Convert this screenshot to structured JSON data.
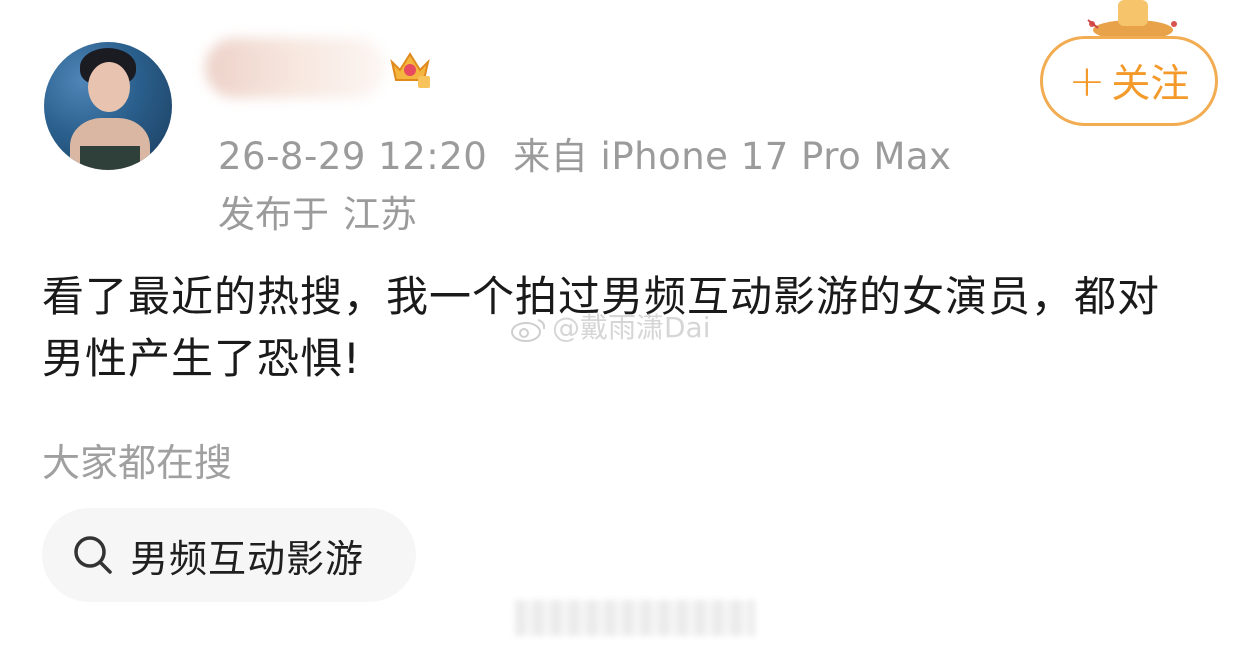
{
  "post": {
    "author": {
      "name_blurred": true,
      "avatar_alt": "avatar",
      "badge_icon": "crown-badge-icon"
    },
    "follow_label": "关注",
    "follow_plus": "+",
    "timestamp": "26-8-29 12:20",
    "source": "来自 iPhone 17 Pro Max",
    "location_prefix": "发布于",
    "location": "江苏",
    "content": "看了最近的热搜，我一个拍过男频互动影游的女演员，都对男性产生了恐惧!",
    "watermark": "@戴雨潇Dai"
  },
  "hot_search": {
    "title": "大家都在搜",
    "items": [
      {
        "icon": "search-icon",
        "label": "男频互动影游"
      }
    ]
  },
  "colors": {
    "accent": "#f39a2b",
    "follow_border": "#f2ac52",
    "meta_text": "#9b9b9b",
    "chip_bg": "#f6f6f6"
  }
}
